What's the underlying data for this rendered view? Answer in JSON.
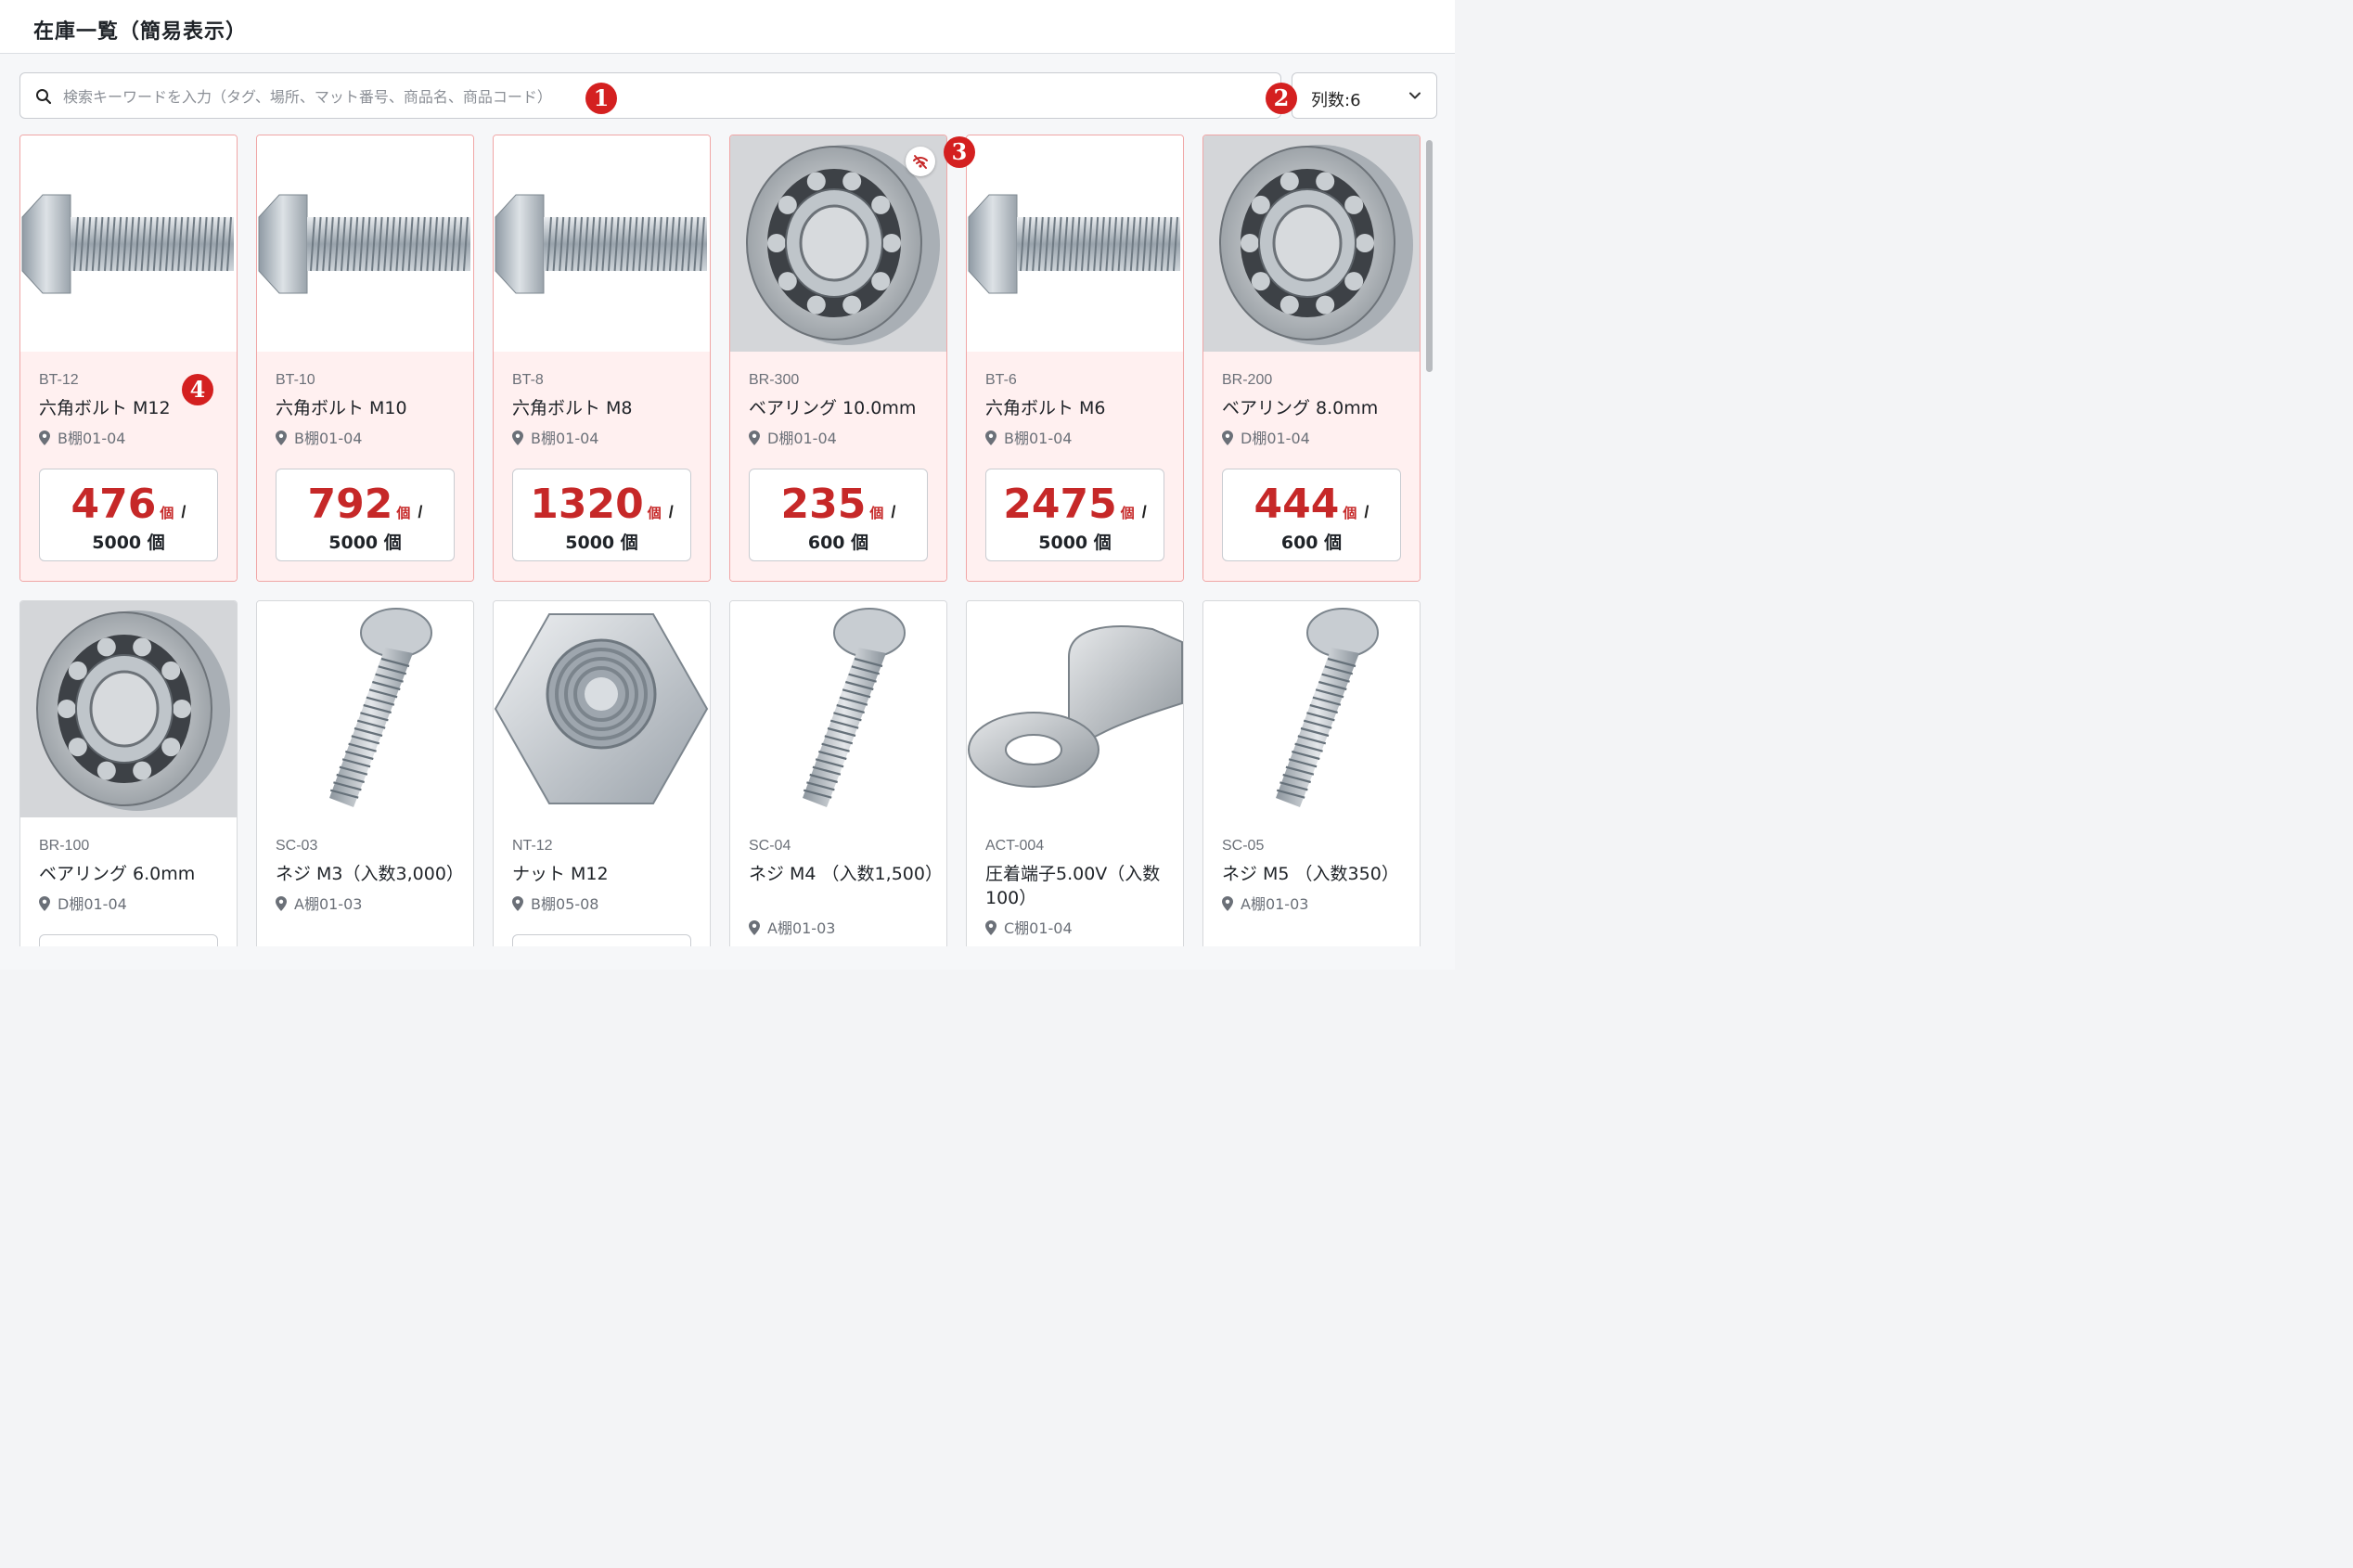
{
  "header": {
    "title": "在庫一覧（簡易表示）"
  },
  "search": {
    "placeholder": "検索キーワードを入力（タグ、場所、マット番号、商品名、商品コード）",
    "value": ""
  },
  "columns": {
    "label": "列数:6"
  },
  "badges": [
    "1",
    "2",
    "3",
    "4"
  ],
  "colors": {
    "alert_border": "#f0a6a6",
    "alert_bg": "#fff0f0",
    "qty_red": "#c62828",
    "badge_red": "#d42020"
  },
  "items": [
    {
      "code": "BT-12",
      "name": "六角ボルト M12",
      "location": "B棚01-04",
      "qty": "476",
      "unit": "個",
      "max": "5000 個",
      "alert": true,
      "image": "bolt-image"
    },
    {
      "code": "BT-10",
      "name": "六角ボルト M10",
      "location": "B棚01-04",
      "qty": "792",
      "unit": "個",
      "max": "5000 個",
      "alert": true,
      "image": "bolt-image"
    },
    {
      "code": "BT-8",
      "name": "六角ボルト M8",
      "location": "B棚01-04",
      "qty": "1320",
      "unit": "個",
      "max": "5000 個",
      "alert": true,
      "image": "bolt-image"
    },
    {
      "code": "BR-300",
      "name": "ベアリング 10.0mm",
      "location": "D棚01-04",
      "qty": "235",
      "unit": "個",
      "max": "600 個",
      "alert": true,
      "image": "bearing-image",
      "offline_icon": "wifi-off-icon"
    },
    {
      "code": "BT-6",
      "name": "六角ボルト M6",
      "location": "B棚01-04",
      "qty": "2475",
      "unit": "個",
      "max": "5000 個",
      "alert": true,
      "image": "bolt-image"
    },
    {
      "code": "BR-200",
      "name": "ベアリング 8.0mm",
      "location": "D棚01-04",
      "qty": "444",
      "unit": "個",
      "max": "600 個",
      "alert": true,
      "image": "bearing-image"
    },
    {
      "code": "BR-100",
      "name": "ベアリング 6.0mm",
      "location": "D棚01-04",
      "alert": false,
      "image": "bearing-image"
    },
    {
      "code": "SC-03",
      "name": "ネジ M3（入数3,000）",
      "location": "A棚01-03",
      "alert": false,
      "image": "screw-image"
    },
    {
      "code": "NT-12",
      "name": "ナット M12",
      "location": "B棚05-08",
      "alert": false,
      "image": "nut-image"
    },
    {
      "code": "SC-04",
      "name": "ネジ M4 （入数1,500）",
      "location": "A棚01-03",
      "alert": false,
      "image": "screw-image"
    },
    {
      "code": "ACT-004",
      "name": "圧着端子5.00V（入数100）",
      "location": "C棚01-04",
      "alert": false,
      "image": "terminal-image"
    },
    {
      "code": "SC-05",
      "name": "ネジ M5 （入数350）",
      "location": "A棚01-03",
      "alert": false,
      "image": "screw-image"
    }
  ]
}
